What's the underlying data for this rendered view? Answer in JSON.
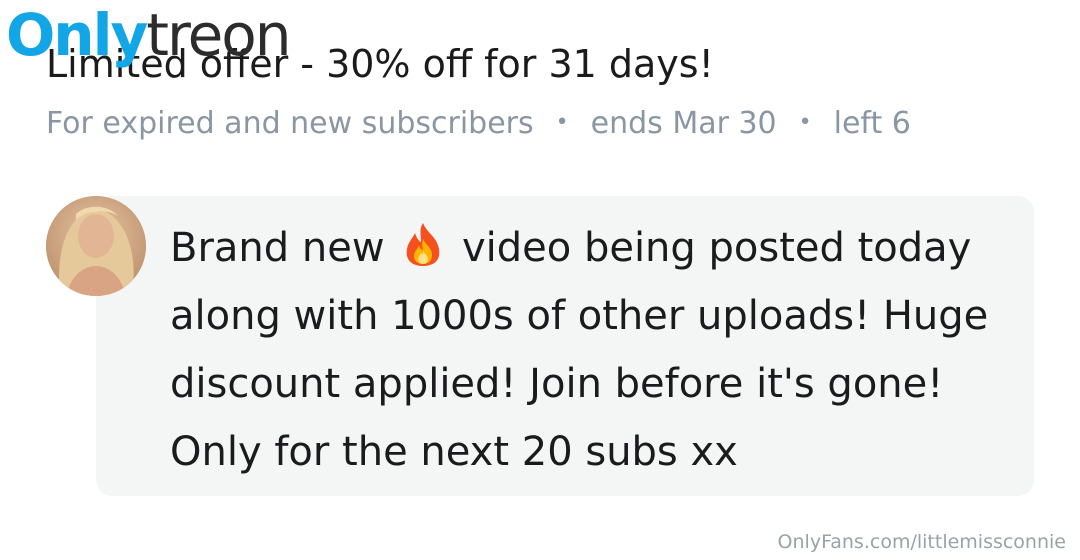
{
  "brand": {
    "logo_part1": "Only",
    "logo_part2": "treon"
  },
  "offer": {
    "title": "Limited offer - 30% off for 31 days!",
    "audience": "For expired and new subscribers",
    "ends": "ends Mar 30",
    "remaining": "left 6",
    "separator": "•"
  },
  "message": {
    "part1": "Brand new",
    "emoji": "fire-icon",
    "part2": "video being posted today along with 1000s of other uploads! Huge discount applied! Join before it's gone! Only for the next 20 subs xx"
  },
  "watermark": "OnlyFans.com/littlemissconnie",
  "colors": {
    "logo_blue": "#12a6e6",
    "meta_gray": "#8a96a3",
    "bubble_bg": "#f4f6f6"
  }
}
